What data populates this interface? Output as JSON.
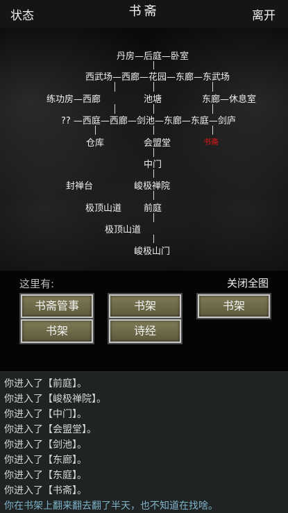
{
  "topbar": {
    "status": "状态",
    "title": "书斋",
    "leave": "离开"
  },
  "map": {
    "row1": "丹房—后庭—卧室",
    "row2": "西武场—西廊—花园—东廊—东武场",
    "row3_left": "练功房—西廊",
    "row3_mid": "池塘",
    "row3_right": "东廊—休息室",
    "row4": "?? —西庭—西廊—剑池—东廊—东庭—剑庐",
    "row5_left": "仓库",
    "row5_mid": "会盟堂",
    "row5_right": "书斋",
    "zhongmen": "中门",
    "fengchantai": "封禅台",
    "junji_chanyuan": "峻极禅院",
    "jiding_shandao_1": "极顶山道",
    "qianting": "前庭",
    "jiding_shandao_2": "极顶山道",
    "junji_shanmen": "峻极山门"
  },
  "panel": {
    "here_label": "这里有:",
    "close_map": "关闭全图",
    "buttons": [
      "书斋管事",
      "书架",
      "书架",
      "书架",
      "诗经"
    ]
  },
  "log": {
    "entries": [
      "你进入了【前庭】。",
      "你进入了【峻极禅院】。",
      "你进入了【中门】。",
      "你进入了【会盟堂】。",
      "你进入了【剑池】。",
      "你进入了【东廊】。",
      "你进入了【东庭】。",
      "你进入了【书斋】。"
    ],
    "last": "你在书架上翻来翻去翻了半天，也不知道在找啥。"
  },
  "colors": {
    "current_room": "#e01818",
    "button_fill": "#6f6b4a",
    "log_highlight": "#7fb3c7"
  }
}
